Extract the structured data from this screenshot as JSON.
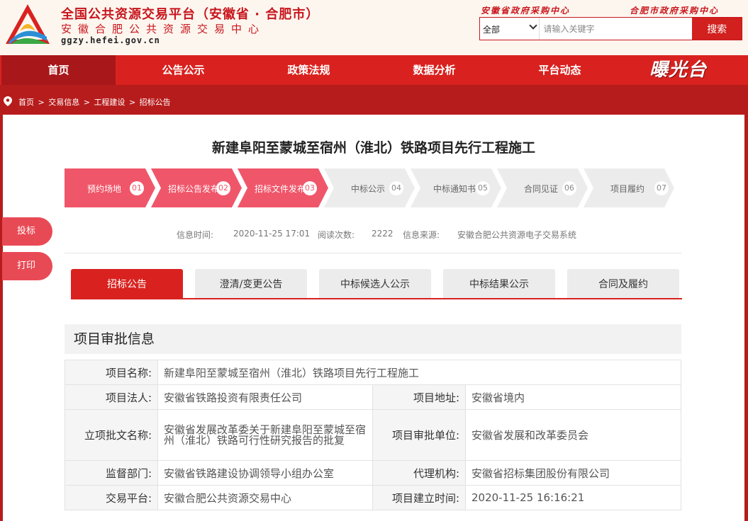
{
  "header": {
    "logo_title": "全国公共资源交易平台（安徽省 · 合肥市）",
    "logo_sub": "安徽合肥公共资源交易中心",
    "logo_domain": "ggzy.hefei.gov.cn",
    "top_link_province": "安徽省政府采购中心",
    "top_link_city": "合肥市政府采购中心",
    "search": {
      "scope": "全部",
      "placeholder": "请输入关键字",
      "button": "搜索"
    }
  },
  "nav": {
    "items": [
      "首页",
      "公告公示",
      "政策法规",
      "数据分析",
      "平台动态"
    ],
    "active": "首页",
    "brand": "曝光台"
  },
  "breadcrumb": [
    "首页",
    ">",
    "交易信息",
    ">",
    "工程建设",
    ">",
    "招标公告"
  ],
  "page": {
    "title": "新建阜阳至蒙城至宿州（淮北）铁路项目先行工程施工"
  },
  "steps": [
    {
      "label": "预约场地",
      "num": "01",
      "done": true
    },
    {
      "label": "招标公告发布",
      "num": "02",
      "done": true
    },
    {
      "label": "招标文件发布",
      "num": "03",
      "done": true
    },
    {
      "label": "中标公示",
      "num": "04",
      "done": false
    },
    {
      "label": "中标通知书",
      "num": "05",
      "done": false
    },
    {
      "label": "合同见证",
      "num": "06",
      "done": false
    },
    {
      "label": "项目履约",
      "num": "07",
      "done": false
    }
  ],
  "meta": {
    "time_label": "信息时间:",
    "time_value": "2020-11-25 17:01",
    "views_label": "阅读次数:",
    "views_value": "2222",
    "source_label": "信息来源:",
    "source_value": "安徽合肥公共资源电子交易系统"
  },
  "side": {
    "complain": "投标",
    "print": "打印"
  },
  "tabs": [
    "招标公告",
    "澄清/变更公告",
    "中标候选人公示",
    "中标结果公示",
    "合同及履约"
  ],
  "section": {
    "title": "项目审批信息",
    "rows": {
      "name_k": "项目名称:",
      "name_v": "新建阜阳至蒙城至宿州（淮北）铁路项目先行工程施工",
      "owner_k": "项目法人:",
      "owner_v": "安徽省铁路投资有限责任公司",
      "addr_k": "项目地址:",
      "addr_v": "安徽省境内",
      "doc_k": "立项批文名称:",
      "doc_v": "安徽省发展改革委关于新建阜阳至蒙城至宿州（淮北）铁路可行性研究报告的批复",
      "unit_k": "项目审批单位:",
      "unit_v": "安徽省发展和改革委员会",
      "super_k": "监督部门:",
      "super_v": "安徽省铁路建设协调领导小组办公室",
      "agent_k": "代理机构:",
      "agent_v": "安徽省招标集团股份有限公司",
      "platform_k": "交易平台:",
      "platform_v": "安徽合肥公共资源交易中心",
      "created_k": "项目建立时间:",
      "created_v": "2020-11-25 16:16:21"
    }
  },
  "colors": {
    "brand_red": "#d9221f",
    "dark_red": "#b71c1c",
    "step_on": "#f0566a",
    "step_off": "#ececec"
  }
}
